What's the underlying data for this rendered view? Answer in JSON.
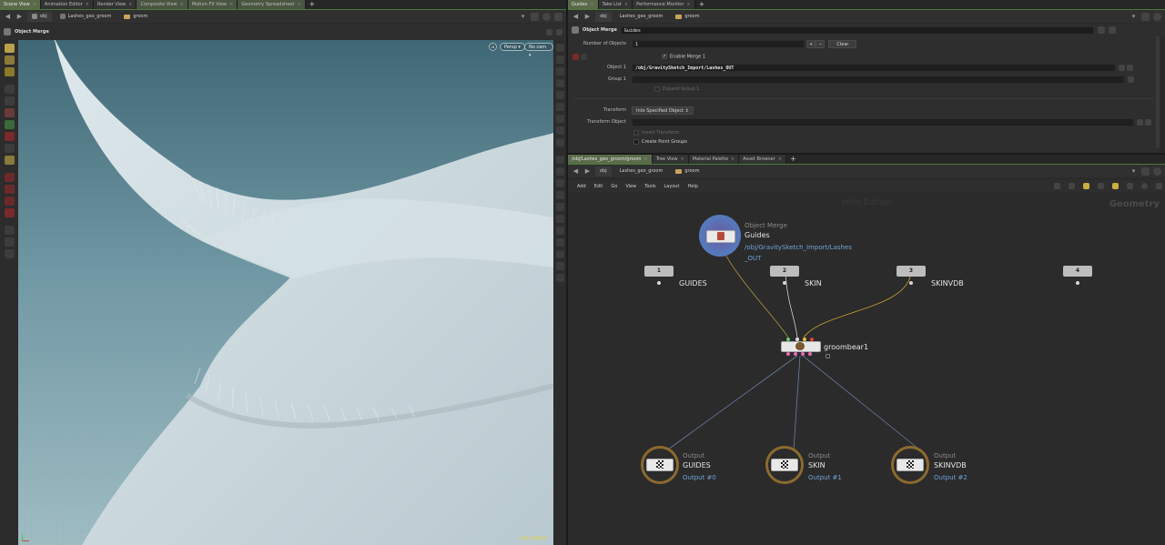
{
  "left_pane": {
    "tabs": [
      {
        "label": "Scene View",
        "active": true
      },
      {
        "label": "Animation Editor"
      },
      {
        "label": "Render View"
      },
      {
        "label": "Composite View"
      },
      {
        "label": "Motion FX View"
      },
      {
        "label": "Geometry Spreadsheet"
      }
    ],
    "path": [
      "obj",
      "Lashes_geo_groom",
      "groom"
    ],
    "title": "Object Merge",
    "viewport": {
      "persp": "Persp ▾",
      "cam": "No cam ▾",
      "watermark": "Indie Edition"
    }
  },
  "right_top": {
    "tabs": [
      {
        "label": "Guides",
        "active": true
      },
      {
        "label": "Take List"
      },
      {
        "label": "Performance Monitor"
      }
    ],
    "path": [
      "obj",
      "Lashes_geo_groom",
      "groom"
    ],
    "node_type": "Object Merge",
    "node_name": "Guides",
    "params": {
      "num_objects_label": "Number of Objects",
      "num_objects_value": "1",
      "clear": "Clear",
      "enable_merge": "Enable Merge 1",
      "object1_label": "Object 1",
      "object1_value": "/obj/GravitySketch_Import/Lashes_OUT",
      "group1_label": "Group 1",
      "expand_group": "Expand Group 1",
      "transform_label": "Transform",
      "transform_value": "Into Specified Object",
      "transform_object_label": "Transform Object",
      "invert_transform": "Invert Transform",
      "create_point_groups": "Create Point Groups"
    }
  },
  "right_bottom": {
    "tabs": [
      {
        "label": "/obj/Lashes_geo_groom/groom",
        "active": true
      },
      {
        "label": "Tree View"
      },
      {
        "label": "Material Palette"
      },
      {
        "label": "Asset Browser"
      }
    ],
    "path": [
      "obj",
      "Lashes_geo_groom",
      "groom"
    ],
    "menu": [
      "Add",
      "Edit",
      "Go",
      "View",
      "Tools",
      "Layout",
      "Help"
    ],
    "network": {
      "watermark": "Indie Edition",
      "context": "Geometry",
      "merge_node": {
        "type": "Object Merge",
        "name": "Guides",
        "path1": "/obj/GravitySketch_Import/Lashes",
        "path2": "_OUT"
      },
      "inputs": [
        {
          "num": "1",
          "label": "GUIDES"
        },
        {
          "num": "2",
          "label": "SKIN"
        },
        {
          "num": "3",
          "label": "SKINVDB"
        },
        {
          "num": "4",
          "label": ""
        }
      ],
      "groom_node": "groombear1",
      "outputs": [
        {
          "type": "Output",
          "name": "GUIDES",
          "index": "Output #0"
        },
        {
          "type": "Output",
          "name": "SKIN",
          "index": "Output #1"
        },
        {
          "type": "Output",
          "name": "SKINVDB",
          "index": "Output #2"
        }
      ]
    }
  }
}
